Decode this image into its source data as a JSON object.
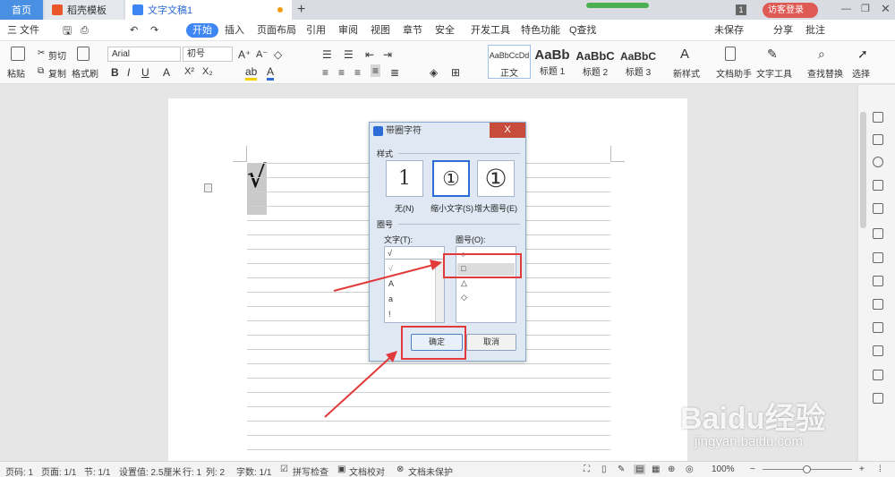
{
  "tabs": {
    "home": "首页",
    "template": "稻壳模板",
    "doc": "文字文稿1",
    "new": "+"
  },
  "window": {
    "doc_count": "1",
    "login": "访客登录"
  },
  "menu": {
    "file": "三 文件",
    "start": "开始",
    "insert": "插入",
    "layout": "页面布局",
    "ref": "引用",
    "review": "审阅",
    "view": "视图",
    "section": "章节",
    "security": "安全",
    "dev": "开发工具",
    "special": "特色功能",
    "search": "Q查找",
    "unsaved": "未保存",
    "share": "分享",
    "comment": "批注"
  },
  "ribbon": {
    "paste": "粘贴",
    "cut": "剪切",
    "copy": "复制",
    "format_painter": "格式刷",
    "font_name": "Arial",
    "font_size": "初号",
    "styles": [
      {
        "preview": "AaBbCcDd",
        "label": "正文"
      },
      {
        "preview": "AaBb",
        "label": "标题 1"
      },
      {
        "preview": "AaBbC",
        "label": "标题 2"
      },
      {
        "preview": "AaBbC",
        "label": "标题 3"
      }
    ],
    "new_style": "新样式",
    "doc_helper": "文档助手",
    "text_tools": "文字工具",
    "find_replace": "查找替换",
    "select": "选择"
  },
  "document": {
    "char": "√"
  },
  "dialog": {
    "title": "带圈字符",
    "style_group": "样式",
    "options": [
      {
        "glyph": "1",
        "label": "无(N)"
      },
      {
        "glyph": "①",
        "label": "缩小文字(S)"
      },
      {
        "glyph": "①",
        "label": "增大圈号(E)"
      }
    ],
    "circle_group": "圈号",
    "text_label": "文字(T):",
    "text_value": "√",
    "text_items": [
      "√",
      "A",
      "a",
      "!"
    ],
    "circle_label": "圈号(O):",
    "circle_items": [
      "○",
      "□",
      "△",
      "◇"
    ],
    "ok": "确定",
    "cancel": "取消",
    "close": "X"
  },
  "status": {
    "page_num": "页码: 1",
    "pages": "页面: 1/1",
    "section": "节: 1/1",
    "setting": "设置值: 2.5厘米",
    "row": "行: 1",
    "col": "列: 2",
    "words": "字数: 1/1",
    "spell": "拼写检查",
    "proof": "文档校对",
    "protect": "文档未保护",
    "zoom": "100%"
  },
  "watermark": {
    "brand": "Baidu经验",
    "url": "jingyan.baidu.com"
  },
  "colors": {
    "accent": "#3f86f5",
    "annotation": "#e23a3a"
  }
}
